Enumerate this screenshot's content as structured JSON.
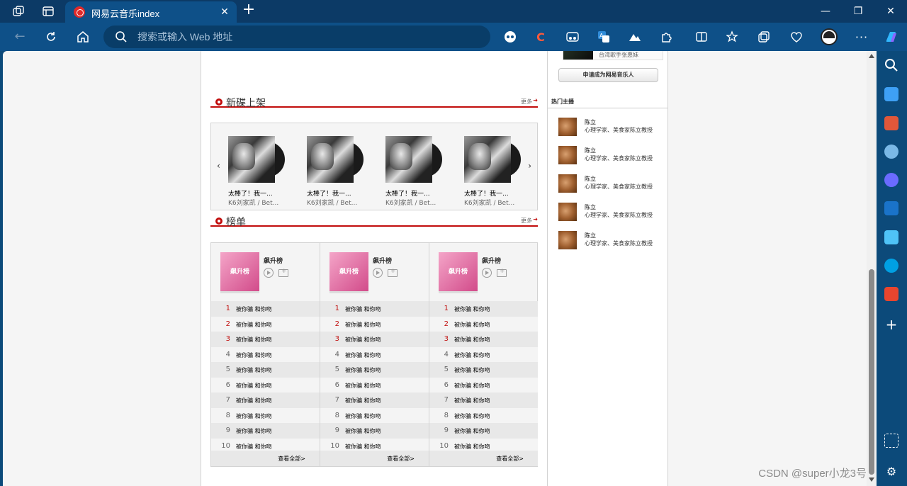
{
  "browser": {
    "tab_title": "网易云音乐index",
    "tab_close": "✕",
    "new_tab": "+",
    "address_placeholder": "搜索或输入 Web 地址",
    "window_controls": [
      "—",
      "❐",
      "✕"
    ]
  },
  "new_albums": {
    "title": "新碟上架",
    "more": "更多",
    "prev": "‹",
    "next": "›",
    "items": [
      {
        "title": "太棒了！我一...",
        "artist": "K6刘家凯 / Bet..."
      },
      {
        "title": "太棒了！我一...",
        "artist": "K6刘家凯 / Bet..."
      },
      {
        "title": "太棒了！我一...",
        "artist": "K6刘家凯 / Bet..."
      },
      {
        "title": "太棒了！我一...",
        "artist": "K6刘家凯 / Bet..."
      }
    ]
  },
  "ranking": {
    "title": "榜单",
    "more": "更多",
    "lists": [
      {
        "cover_label": "飙升榜",
        "name": "飙升榜",
        "view_all": "查看全部>"
      },
      {
        "cover_label": "飙升榜",
        "name": "飙升榜",
        "view_all": "查看全部>"
      },
      {
        "cover_label": "飙升榜",
        "name": "飙升榜",
        "view_all": "查看全部>"
      }
    ],
    "songs": [
      {
        "rank": "1",
        "song": "被你骗 和你吻"
      },
      {
        "rank": "2",
        "song": "被你骗 和你吻"
      },
      {
        "rank": "3",
        "song": "被你骗 和你吻"
      },
      {
        "rank": "4",
        "song": "被你骗 和你吻"
      },
      {
        "rank": "5",
        "song": "被你骗 和你吻"
      },
      {
        "rank": "6",
        "song": "被你骗 和你吻"
      },
      {
        "rank": "7",
        "song": "被你骗 和你吻"
      },
      {
        "rank": "8",
        "song": "被你骗 和你吻"
      },
      {
        "rank": "9",
        "song": "被你骗 和你吻"
      },
      {
        "rank": "10",
        "song": "被你骗 和你吻"
      }
    ]
  },
  "sidebar": {
    "singer_desc": "台湾歌手张惠妹",
    "apply_button": "申请成为网易音乐人",
    "hot_anchors_title": "热门主播",
    "anchors": [
      {
        "name": "陈立",
        "desc": "心理学家、美食家陈立教授"
      },
      {
        "name": "陈立",
        "desc": "心理学家、美食家陈立教授"
      },
      {
        "name": "陈立",
        "desc": "心理学家、美食家陈立教授"
      },
      {
        "name": "陈立",
        "desc": "心理学家、美食家陈立教授"
      },
      {
        "name": "陈立",
        "desc": "心理学家、美食家陈立教授"
      }
    ]
  },
  "watermark": "CSDN @super小龙3号",
  "colors": {
    "accent_red": "#c10d0c",
    "browser_frame": "#0c3a66",
    "toolbar": "#0e5088"
  }
}
